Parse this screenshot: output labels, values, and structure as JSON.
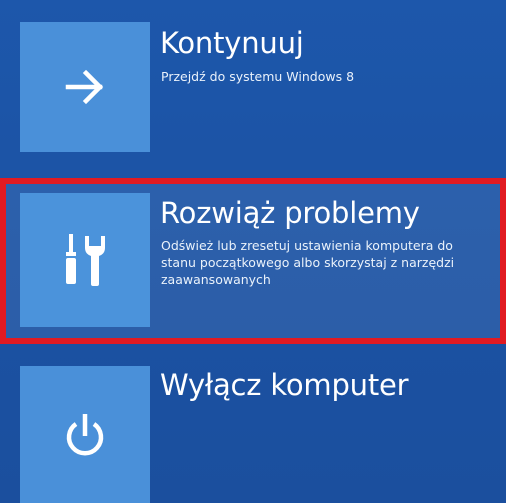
{
  "options": [
    {
      "title": "Kontynuuj",
      "description": "Przejdź do systemu Windows 8",
      "icon": "arrow-right-icon"
    },
    {
      "title": "Rozwiąż problemy",
      "description": "Odśwież lub zresetuj ustawienia komputera do stanu początkowego albo skorzystaj z narzędzi zaawansowanych",
      "icon": "tools-icon",
      "highlighted": true
    },
    {
      "title": "Wyłącz komputer",
      "description": "",
      "icon": "power-icon"
    }
  ],
  "colors": {
    "background": "#1d57ab",
    "tile": "#4a90d9",
    "highlight_border": "#e11b22",
    "text": "#ffffff"
  }
}
